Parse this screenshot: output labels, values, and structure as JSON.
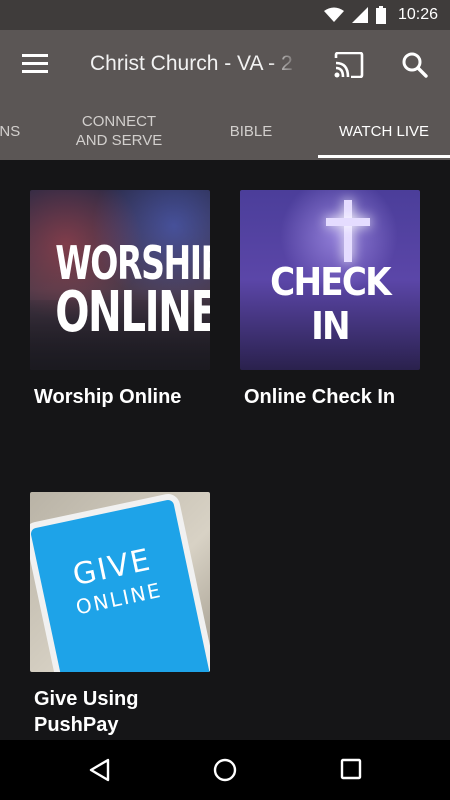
{
  "status_bar": {
    "time": "10:26",
    "icons": [
      "wifi-icon",
      "signal-icon",
      "battery-icon"
    ]
  },
  "app_bar": {
    "title": "Christ Church - VA - 2",
    "menu_icon": "hamburger-menu-icon",
    "cast_icon": "cast-icon",
    "search_icon": "search-icon"
  },
  "tabs": [
    {
      "label": "ONS",
      "active": false
    },
    {
      "label": "CONNECT AND SERVE",
      "active": false
    },
    {
      "label": "BIBLE",
      "active": false
    },
    {
      "label": "WATCH LIVE",
      "active": true
    }
  ],
  "tiles": [
    {
      "label": "Worship Online",
      "image_line1": "WORSHIP",
      "image_line2": "ONLINE"
    },
    {
      "label": "Online Check In",
      "image_text": "CHECK IN"
    },
    {
      "label": "Give Using PushPay",
      "image_line1": "GIVE",
      "image_line2": "ONLINE"
    }
  ],
  "nav_bar": {
    "icons": [
      "back-icon",
      "home-icon",
      "recents-icon"
    ]
  },
  "colors": {
    "status_bar": "#3f3c3b",
    "app_bar": "#5b5655",
    "background": "#151517",
    "tab_indicator": "#ffffff"
  }
}
